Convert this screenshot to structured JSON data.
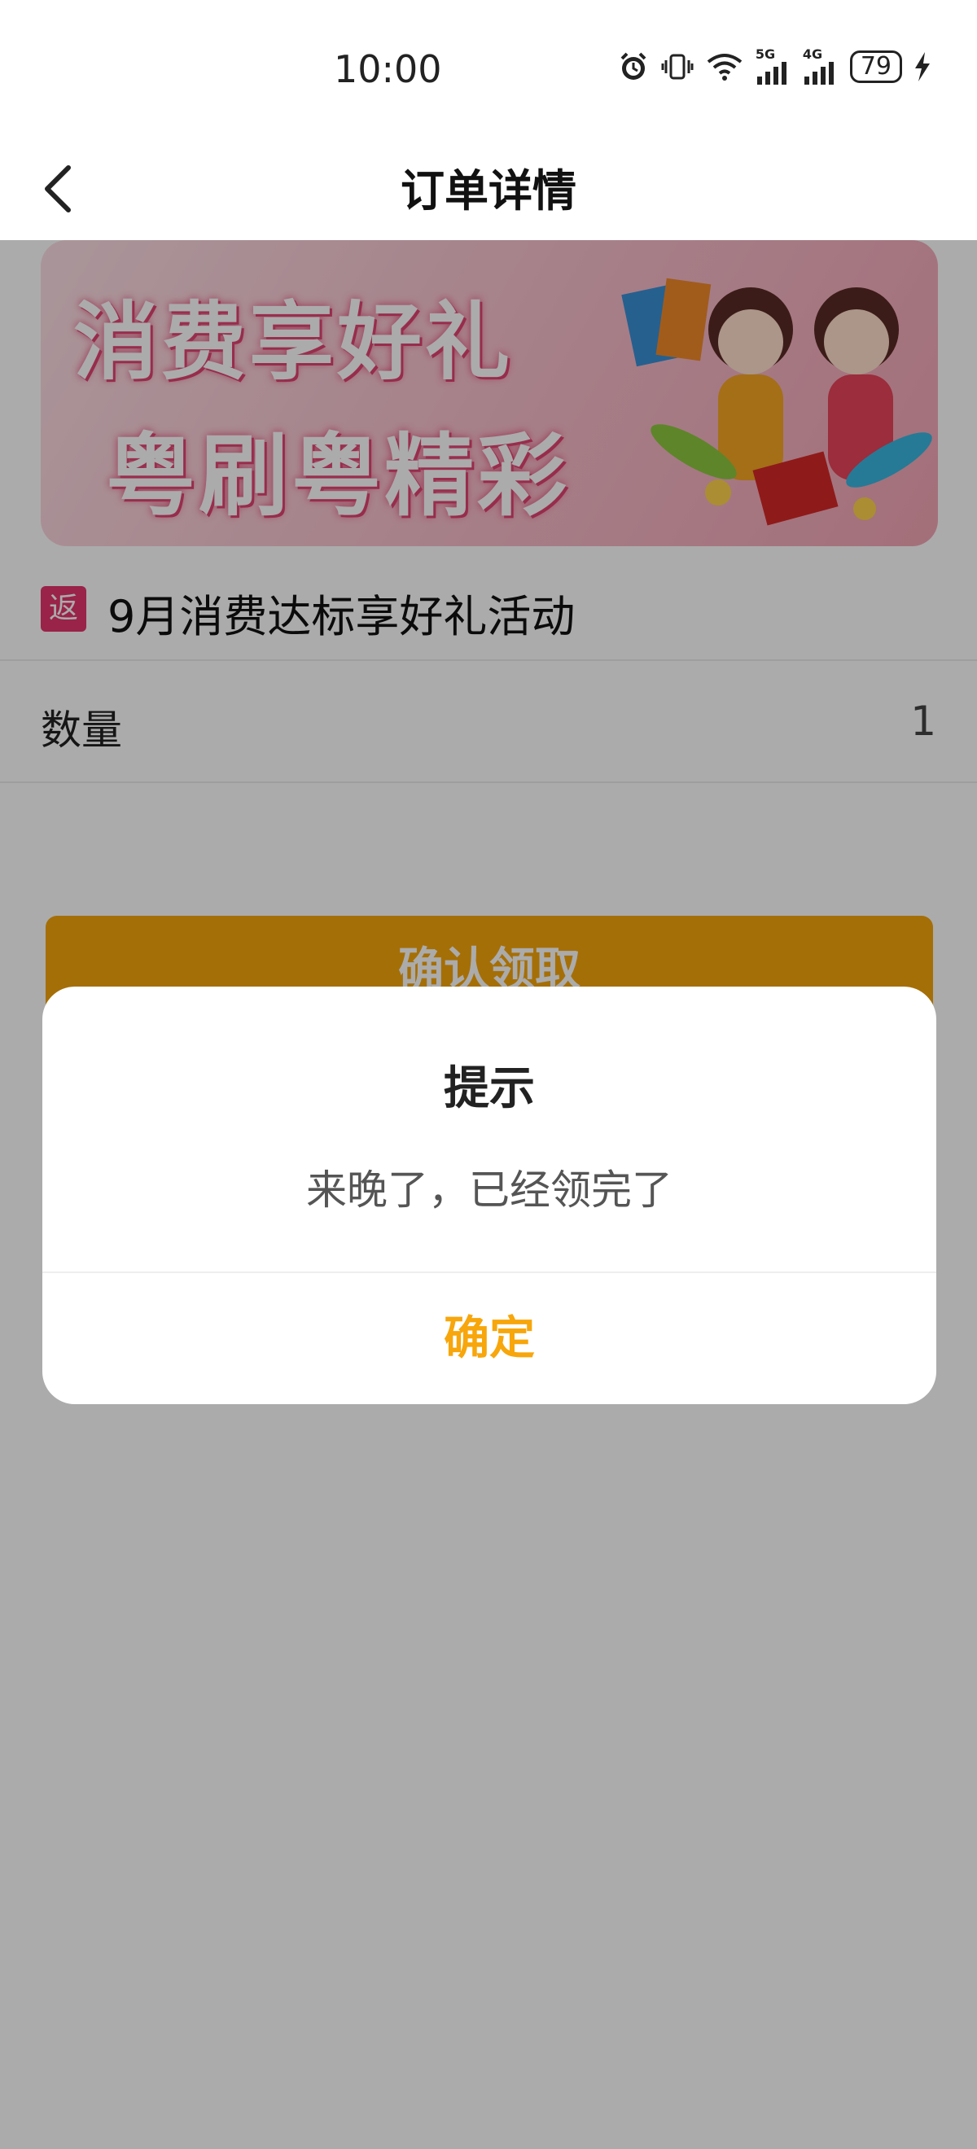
{
  "status_bar": {
    "time": "10:00",
    "battery": "79",
    "network_5g": "5G",
    "network_4g": "4G"
  },
  "header": {
    "title": "订单详情"
  },
  "banner": {
    "line1": "消费享好礼",
    "line2": "粤刷粤精彩"
  },
  "order": {
    "tag": "返",
    "title": "9月消费达标享好礼活动",
    "quantity_label": "数量",
    "quantity_value": "1"
  },
  "confirm_button": {
    "label": "确认领取"
  },
  "dialog": {
    "title": "提示",
    "message": "来晚了，已经领完了",
    "ok_label": "确定"
  },
  "colors": {
    "accent": "#f7a60b",
    "tag_bg": "#e5356e",
    "overlay": "rgba(0,0,0,0.33)"
  },
  "icons": [
    "back-arrow-icon",
    "alarm-icon",
    "vibrate-icon",
    "wifi-icon",
    "signal-5g-icon",
    "signal-4g-icon",
    "battery-icon",
    "charging-icon"
  ]
}
